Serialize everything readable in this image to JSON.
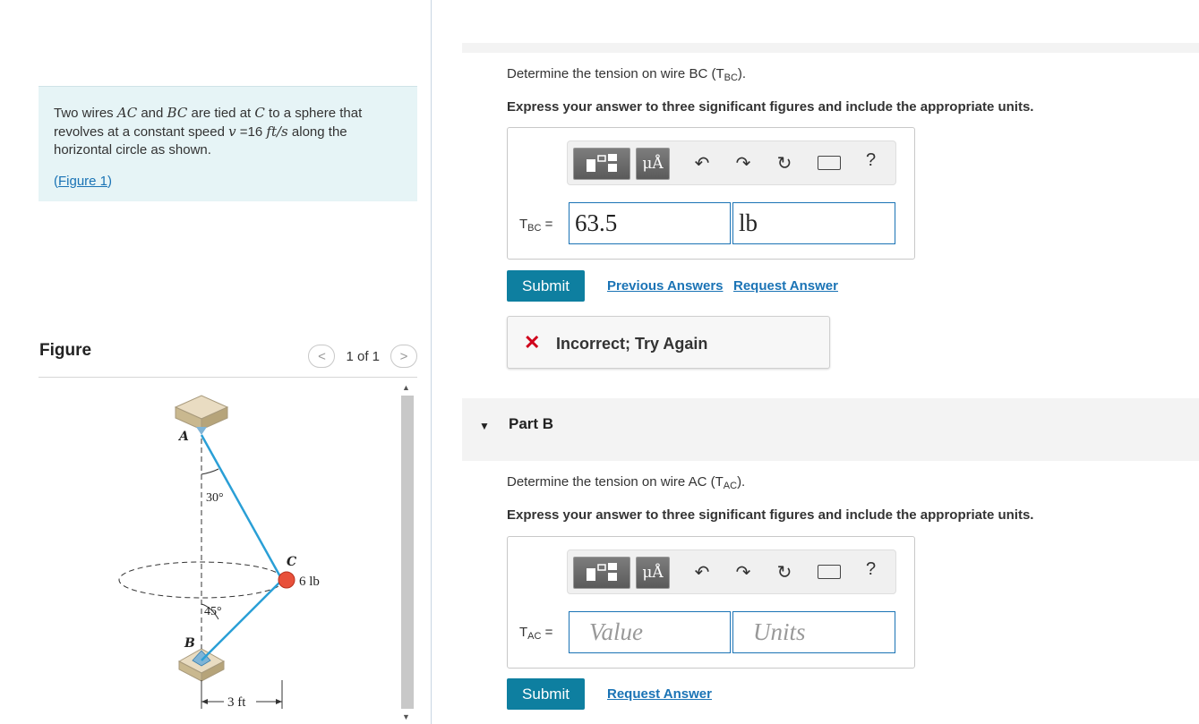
{
  "problem": {
    "text_1": "Two wires ",
    "var_ac": "AC",
    "text_2": " and ",
    "var_bc": "BC",
    "text_3": " are tied at ",
    "var_c": "C",
    "text_4": " to a sphere that revolves at a constant speed ",
    "var_v": "v",
    "text_5": " =16 ",
    "unit": "ft/s",
    "text_6": " along the horizontal circle as shown.",
    "figure_link": "Figure 1",
    "paren_open": "(",
    "paren_close": ")"
  },
  "figure_panel": {
    "title": "Figure",
    "pager_prev": "<",
    "pager_text": "1 of 1",
    "pager_next": ">",
    "labels": {
      "A": "A",
      "B": "B",
      "C": "C",
      "angle_top": "30°",
      "angle_bottom": "45°",
      "weight": "6 lb",
      "distance": "3 ft"
    }
  },
  "part_a": {
    "question_prefix": "Determine the tension on wire BC (T",
    "question_sub": "BC",
    "question_suffix": ").",
    "instruction": "Express your answer to three significant figures and include the appropriate units.",
    "answer_label_main": "T",
    "answer_label_sub": "BC",
    "answer_label_eq": " =",
    "value": "63.5",
    "units": "lb",
    "submit": "Submit",
    "previous_answers": "Previous Answers",
    "request_answer": "Request Answer",
    "feedback_icon": "✕",
    "feedback": "Incorrect; Try Again"
  },
  "toolbar": {
    "mu_label": "μÅ",
    "help": "?",
    "icons": [
      "templates-icon",
      "units-icon",
      "undo-icon",
      "redo-icon",
      "reset-icon",
      "keyboard-icon",
      "help-icon"
    ]
  },
  "part_b": {
    "title": "Part B",
    "question_prefix": "Determine the tension on wire AC (T",
    "question_sub": "AC",
    "question_suffix": ").",
    "instruction": "Express your answer to three significant figures and include the appropriate units.",
    "answer_label_main": "T",
    "answer_label_sub": "AC",
    "answer_label_eq": " =",
    "value_placeholder": "Value",
    "units_placeholder": "Units",
    "submit": "Submit",
    "request_answer": "Request Answer"
  },
  "colors": {
    "accent": "#0e7fa0",
    "link": "#1a73b5",
    "problem_bg": "#e6f4f6",
    "error": "#d0021b",
    "wire": "#2a9fd6",
    "sphere": "#e8503a"
  }
}
